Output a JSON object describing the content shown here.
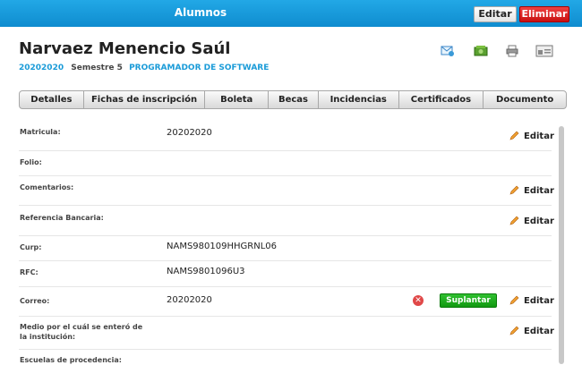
{
  "header": {
    "title": "Alumnos",
    "edit_label": "Editar",
    "delete_label": "Eliminar"
  },
  "student": {
    "name": "Narvaez Menencio Saúl",
    "matricula": "20202020",
    "semester": "Semestre 5",
    "program": "PROGRAMADOR DE SOFTWARE"
  },
  "tabs": [
    "Detalles",
    "Fichas de inscripción",
    "Boleta",
    "Becas",
    "Incidencias",
    "Certificados",
    "Documento"
  ],
  "fields": {
    "matricula": {
      "label": "Matricula:",
      "value": "20202020"
    },
    "folio": {
      "label": "Folio:",
      "value": ""
    },
    "comentarios": {
      "label": "Comentarios:",
      "value": ""
    },
    "referencia": {
      "label": "Referencia Bancaria:",
      "value": ""
    },
    "curp": {
      "label": "Curp:",
      "value": "NAMS980109HHGRNL06"
    },
    "rfc": {
      "label": "RFC:",
      "value": "NAMS9801096U3"
    },
    "correo": {
      "label": "Correo:",
      "value": "20202020"
    },
    "medio": {
      "label": "Medio por el cuál se enteró de la institución:",
      "value": ""
    },
    "escuelas": {
      "label": "Escuelas de procedencia:",
      "value": ""
    }
  },
  "actions": {
    "edit": "Editar",
    "suplantar": "Suplantar",
    "remove_symbol": "✕"
  },
  "icons": [
    "email-icon",
    "money-icon",
    "print-icon",
    "id-card-icon",
    "pencil-icon"
  ]
}
